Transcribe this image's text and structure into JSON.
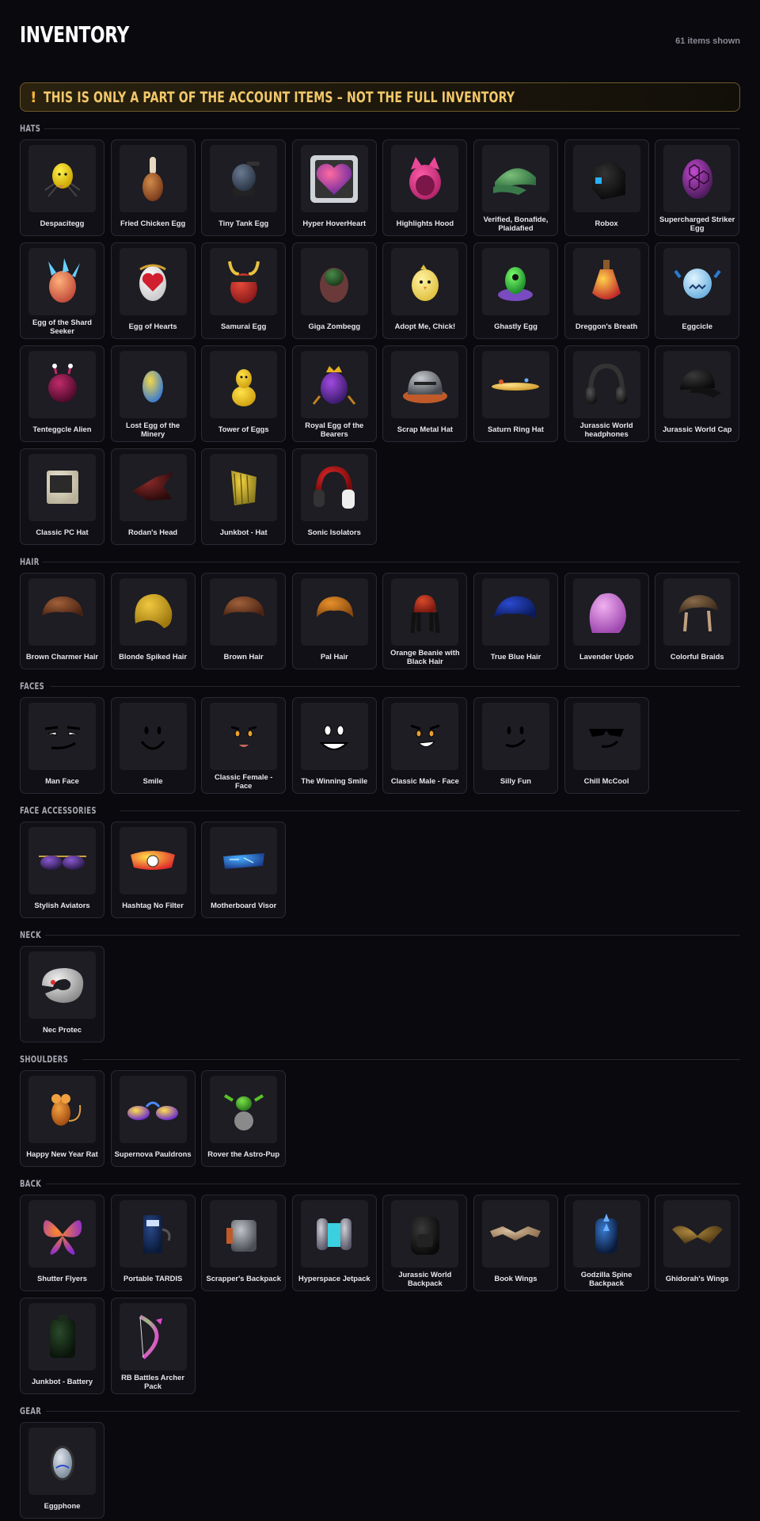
{
  "header": {
    "title": "INVENTORY",
    "items_shown": "61 items shown"
  },
  "banner": {
    "icon": "!",
    "text": "THIS IS ONLY A PART OF THE ACCOUNT ITEMS – NOT THE FULL INVENTORY",
    "accent_color": "#f2b53b"
  },
  "sections": [
    {
      "title": "HATS",
      "items": [
        {
          "name": "Despacitegg",
          "icon": "yellow-spider-egg-icon"
        },
        {
          "name": "Fried Chicken Egg",
          "icon": "chicken-drumstick-icon"
        },
        {
          "name": "Tiny Tank Egg",
          "icon": "tank-egg-icon"
        },
        {
          "name": "Hyper HoverHeart",
          "icon": "framed-heart-icon"
        },
        {
          "name": "Highlights Hood",
          "icon": "pink-cat-hood-icon"
        },
        {
          "name": "Verified, Bonafide, Plaidafied",
          "icon": "green-plaid-cap-icon"
        },
        {
          "name": "Robox",
          "icon": "black-box-icon"
        },
        {
          "name": "Supercharged Striker Egg",
          "icon": "purple-hex-egg-icon"
        },
        {
          "name": "Egg of the Shard Seeker",
          "icon": "crystal-egg-icon"
        },
        {
          "name": "Egg of Hearts",
          "icon": "heart-egg-icon"
        },
        {
          "name": "Samurai Egg",
          "icon": "samurai-egg-icon"
        },
        {
          "name": "Giga Zombegg",
          "icon": "zombie-egg-icon"
        },
        {
          "name": "Adopt Me, Chick!",
          "icon": "chick-icon"
        },
        {
          "name": "Ghastly Egg",
          "icon": "ghost-egg-icon"
        },
        {
          "name": "Dreggon's Breath",
          "icon": "potion-icon"
        },
        {
          "name": "Eggcicle",
          "icon": "ice-monster-icon"
        },
        {
          "name": "Tenteggcle Alien",
          "icon": "alien-egg-icon"
        },
        {
          "name": "Lost Egg of the Minery",
          "icon": "ore-egg-icon"
        },
        {
          "name": "Tower of Eggs",
          "icon": "egg-tower-icon"
        },
        {
          "name": "Royal Egg of the Bearers",
          "icon": "royal-egg-icon"
        },
        {
          "name": "Scrap Metal Hat",
          "icon": "scrap-helmet-icon"
        },
        {
          "name": "Saturn Ring Hat",
          "icon": "saturn-ring-icon"
        },
        {
          "name": "Jurassic World headphones",
          "icon": "headphones-icon"
        },
        {
          "name": "Jurassic World Cap",
          "icon": "black-cap-icon"
        },
        {
          "name": "Classic PC Hat",
          "icon": "pc-monitor-icon"
        },
        {
          "name": "Rodan's Head",
          "icon": "rodan-head-icon"
        },
        {
          "name": "Junkbot - Hat",
          "icon": "junkbot-hat-icon"
        },
        {
          "name": "Sonic Isolators",
          "icon": "red-headphones-icon"
        }
      ]
    },
    {
      "title": "HAIR",
      "items": [
        {
          "name": "Brown Charmer Hair",
          "icon": "brown-hair-icon"
        },
        {
          "name": "Blonde Spiked Hair",
          "icon": "blonde-hair-icon"
        },
        {
          "name": "Brown Hair",
          "icon": "brown-hair-icon"
        },
        {
          "name": "Pal Hair",
          "icon": "orange-hair-icon"
        },
        {
          "name": "Orange Beanie with Black Hair",
          "icon": "beanie-hair-icon"
        },
        {
          "name": "True Blue Hair",
          "icon": "blue-hair-icon"
        },
        {
          "name": "Lavender Updo",
          "icon": "lavender-hair-icon"
        },
        {
          "name": "Colorful Braids",
          "icon": "braids-hair-icon"
        }
      ]
    },
    {
      "title": "FACES",
      "items": [
        {
          "name": "Man Face",
          "icon": "man-face-icon"
        },
        {
          "name": "Smile",
          "icon": "smile-face-icon"
        },
        {
          "name": "Classic Female - Face",
          "icon": "female-face-icon"
        },
        {
          "name": "The Winning Smile",
          "icon": "winning-smile-icon"
        },
        {
          "name": "Classic Male - Face",
          "icon": "male-face-icon"
        },
        {
          "name": "Silly Fun",
          "icon": "silly-face-icon"
        },
        {
          "name": "Chill McCool",
          "icon": "cool-face-icon"
        }
      ]
    },
    {
      "title": "FACE ACCESSORIES",
      "items": [
        {
          "name": "Stylish Aviators",
          "icon": "aviators-icon"
        },
        {
          "name": "Hashtag No Filter",
          "icon": "visor-glasses-icon"
        },
        {
          "name": "Motherboard Visor",
          "icon": "motherboard-visor-icon"
        }
      ]
    },
    {
      "title": "NECK",
      "items": [
        {
          "name": "Nec Protec",
          "icon": "neck-pillow-icon"
        }
      ]
    },
    {
      "title": "SHOULDERS",
      "items": [
        {
          "name": "Happy New Year Rat",
          "icon": "rat-icon"
        },
        {
          "name": "Supernova Pauldrons",
          "icon": "pauldrons-icon"
        },
        {
          "name": "Rover the Astro-Pup",
          "icon": "astro-pup-icon"
        }
      ]
    },
    {
      "title": "BACK",
      "items": [
        {
          "name": "Shutter Flyers",
          "icon": "butterfly-wings-icon"
        },
        {
          "name": "Portable TARDIS",
          "icon": "tardis-icon"
        },
        {
          "name": "Scrapper's Backpack",
          "icon": "scrap-backpack-icon"
        },
        {
          "name": "Hyperspace Jetpack",
          "icon": "jetpack-icon"
        },
        {
          "name": "Jurassic World Backpack",
          "icon": "black-backpack-icon"
        },
        {
          "name": "Book Wings",
          "icon": "book-wings-icon"
        },
        {
          "name": "Godzilla Spine Backpack",
          "icon": "spine-backpack-icon"
        },
        {
          "name": "Ghidorah's Wings",
          "icon": "dragon-wings-icon"
        },
        {
          "name": "Junkbot - Battery",
          "icon": "battery-icon"
        },
        {
          "name": "RB Battles Archer Pack",
          "icon": "bow-pack-icon"
        }
      ]
    },
    {
      "title": "GEAR",
      "items": [
        {
          "name": "Eggphone",
          "icon": "eggphone-icon"
        }
      ]
    }
  ]
}
